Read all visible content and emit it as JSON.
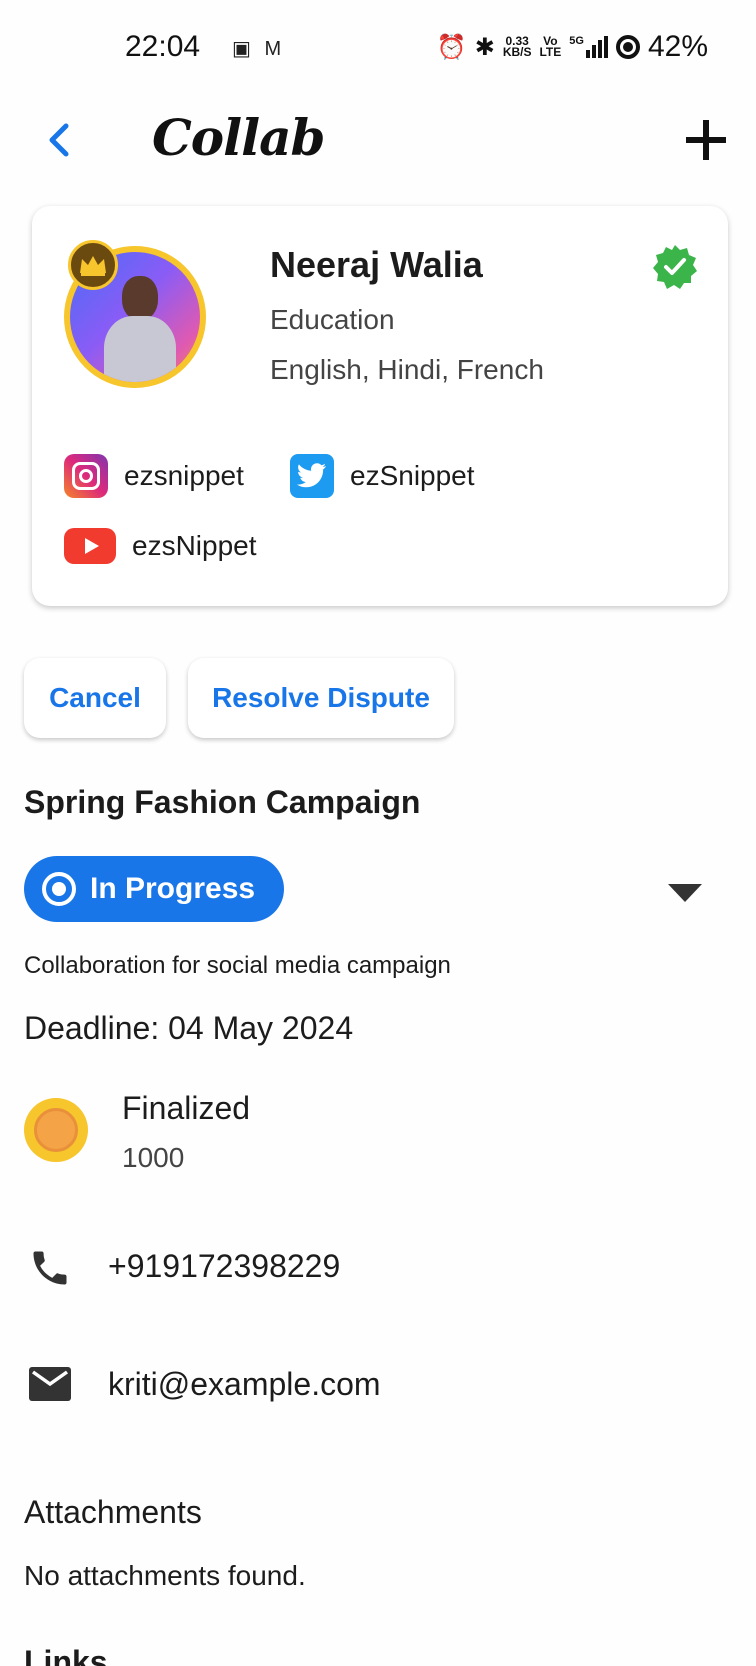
{
  "status_bar": {
    "time": "22:04",
    "left_icons": "▣ M",
    "net_speed_top": "0.33",
    "net_speed_bottom": "KB/S",
    "volte_top": "Vo",
    "volte_bottom": "LTE",
    "network": "5G",
    "battery": "42%"
  },
  "app_bar": {
    "back_icon": "chevron-left",
    "title": "Collab",
    "add_icon": "plus"
  },
  "profile": {
    "name": "Neeraj Walia",
    "category": "Education",
    "languages": "English, Hindi, French",
    "verified": true,
    "premium_badge_icon": "crown",
    "socials": [
      {
        "platform": "instagram",
        "handle": "ezsnippet"
      },
      {
        "platform": "twitter",
        "handle": "ezSnippet"
      },
      {
        "platform": "youtube",
        "handle": "ezsNippet"
      }
    ]
  },
  "actions": {
    "cancel_label": "Cancel",
    "resolve_label": "Resolve Dispute"
  },
  "campaign": {
    "title": "Spring Fashion Campaign",
    "status": "In Progress",
    "description": "Collaboration for social media campaign",
    "deadline": "Deadline: 04 May 2024",
    "amount_label": "Finalized",
    "amount_value": "1000"
  },
  "contact": {
    "phone": "+919172398229",
    "email": "kriti@example.com"
  },
  "attachments": {
    "title": "Attachments",
    "empty_text": "No attachments found."
  },
  "links": {
    "title": "Links"
  },
  "colors": {
    "accent": "#1976e8",
    "verified_green": "#3bb54a",
    "avatar_ring": "#f7c52c",
    "coin": "#f7c52c"
  }
}
